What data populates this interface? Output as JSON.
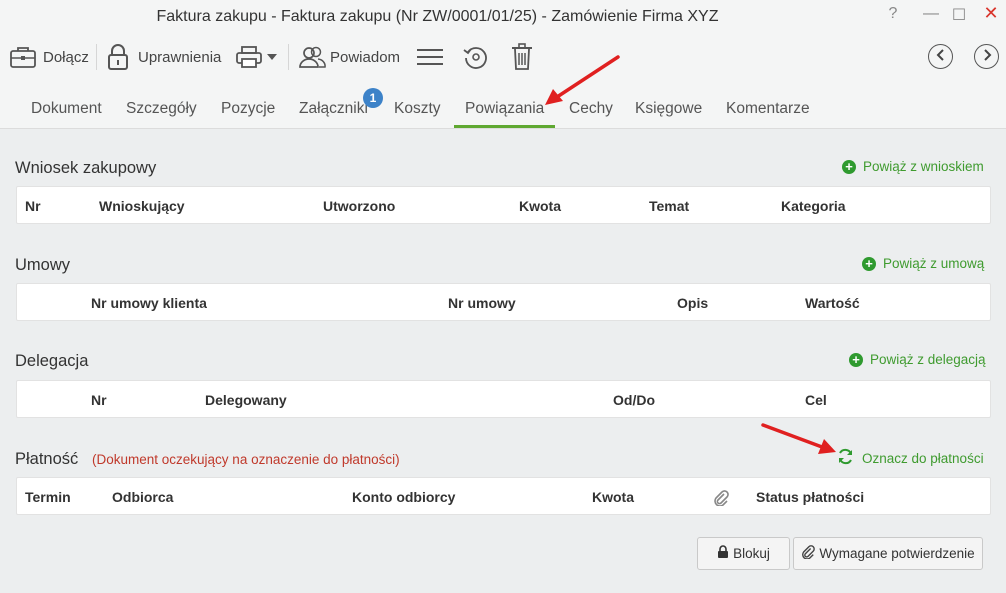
{
  "window": {
    "title": "Faktura zakupu - Faktura zakupu (Nr ZW/0001/01/25) - Zamówienie Firma XYZ",
    "help": "?",
    "minimize": "—",
    "maximize": "☐",
    "close": "✕"
  },
  "toolbar": {
    "attach_label": "Dołącz",
    "permissions_label": "Uprawnienia",
    "notify_label": "Powiadom",
    "icons": [
      "briefcase-icon",
      "lock-icon",
      "printer-icon",
      "people-icon",
      "menu-icon",
      "history-icon",
      "trash-icon",
      "chevron-left-icon",
      "chevron-right-icon"
    ]
  },
  "tabs": [
    {
      "label": "Dokument"
    },
    {
      "label": "Szczegóły"
    },
    {
      "label": "Pozycje"
    },
    {
      "label": "Załączniki",
      "badge": "1"
    },
    {
      "label": "Koszty"
    },
    {
      "label": "Powiązania",
      "active": true
    },
    {
      "label": "Cechy"
    },
    {
      "label": "Księgowe"
    },
    {
      "label": "Komentarze"
    }
  ],
  "sections": {
    "requests": {
      "title": "Wniosek zakupowy",
      "link": "Powiąż z wnioskiem",
      "columns": [
        "Nr",
        "Wnioskujący",
        "Utworzono",
        "Kwota",
        "Temat",
        "Kategoria"
      ]
    },
    "contracts": {
      "title": "Umowy",
      "link": "Powiąż z umową",
      "columns": [
        "Nr umowy klienta",
        "Nr umowy",
        "Opis",
        "Wartość"
      ]
    },
    "delegation": {
      "title": "Delegacja",
      "link": "Powiąż z delegacją",
      "columns": [
        "Nr",
        "Delegowany",
        "Od/Do",
        "Cel"
      ]
    },
    "payment": {
      "title": "Płatność",
      "note": "(Dokument oczekujący na oznaczenie do płatności)",
      "link": "Oznacz do płatności",
      "columns": [
        "Termin",
        "Odbiorca",
        "Konto odbiorcy",
        "Kwota",
        "Status płatności"
      ]
    }
  },
  "buttons": {
    "block": "Blokuj",
    "required_confirmation": "Wymagane potwierdzenie"
  },
  "colors": {
    "accent_green": "#5fa831",
    "link_green": "#3f9b2f",
    "badge_blue": "#3c82c8",
    "note_red": "#c0392b",
    "annotation_red": "#e02020"
  }
}
